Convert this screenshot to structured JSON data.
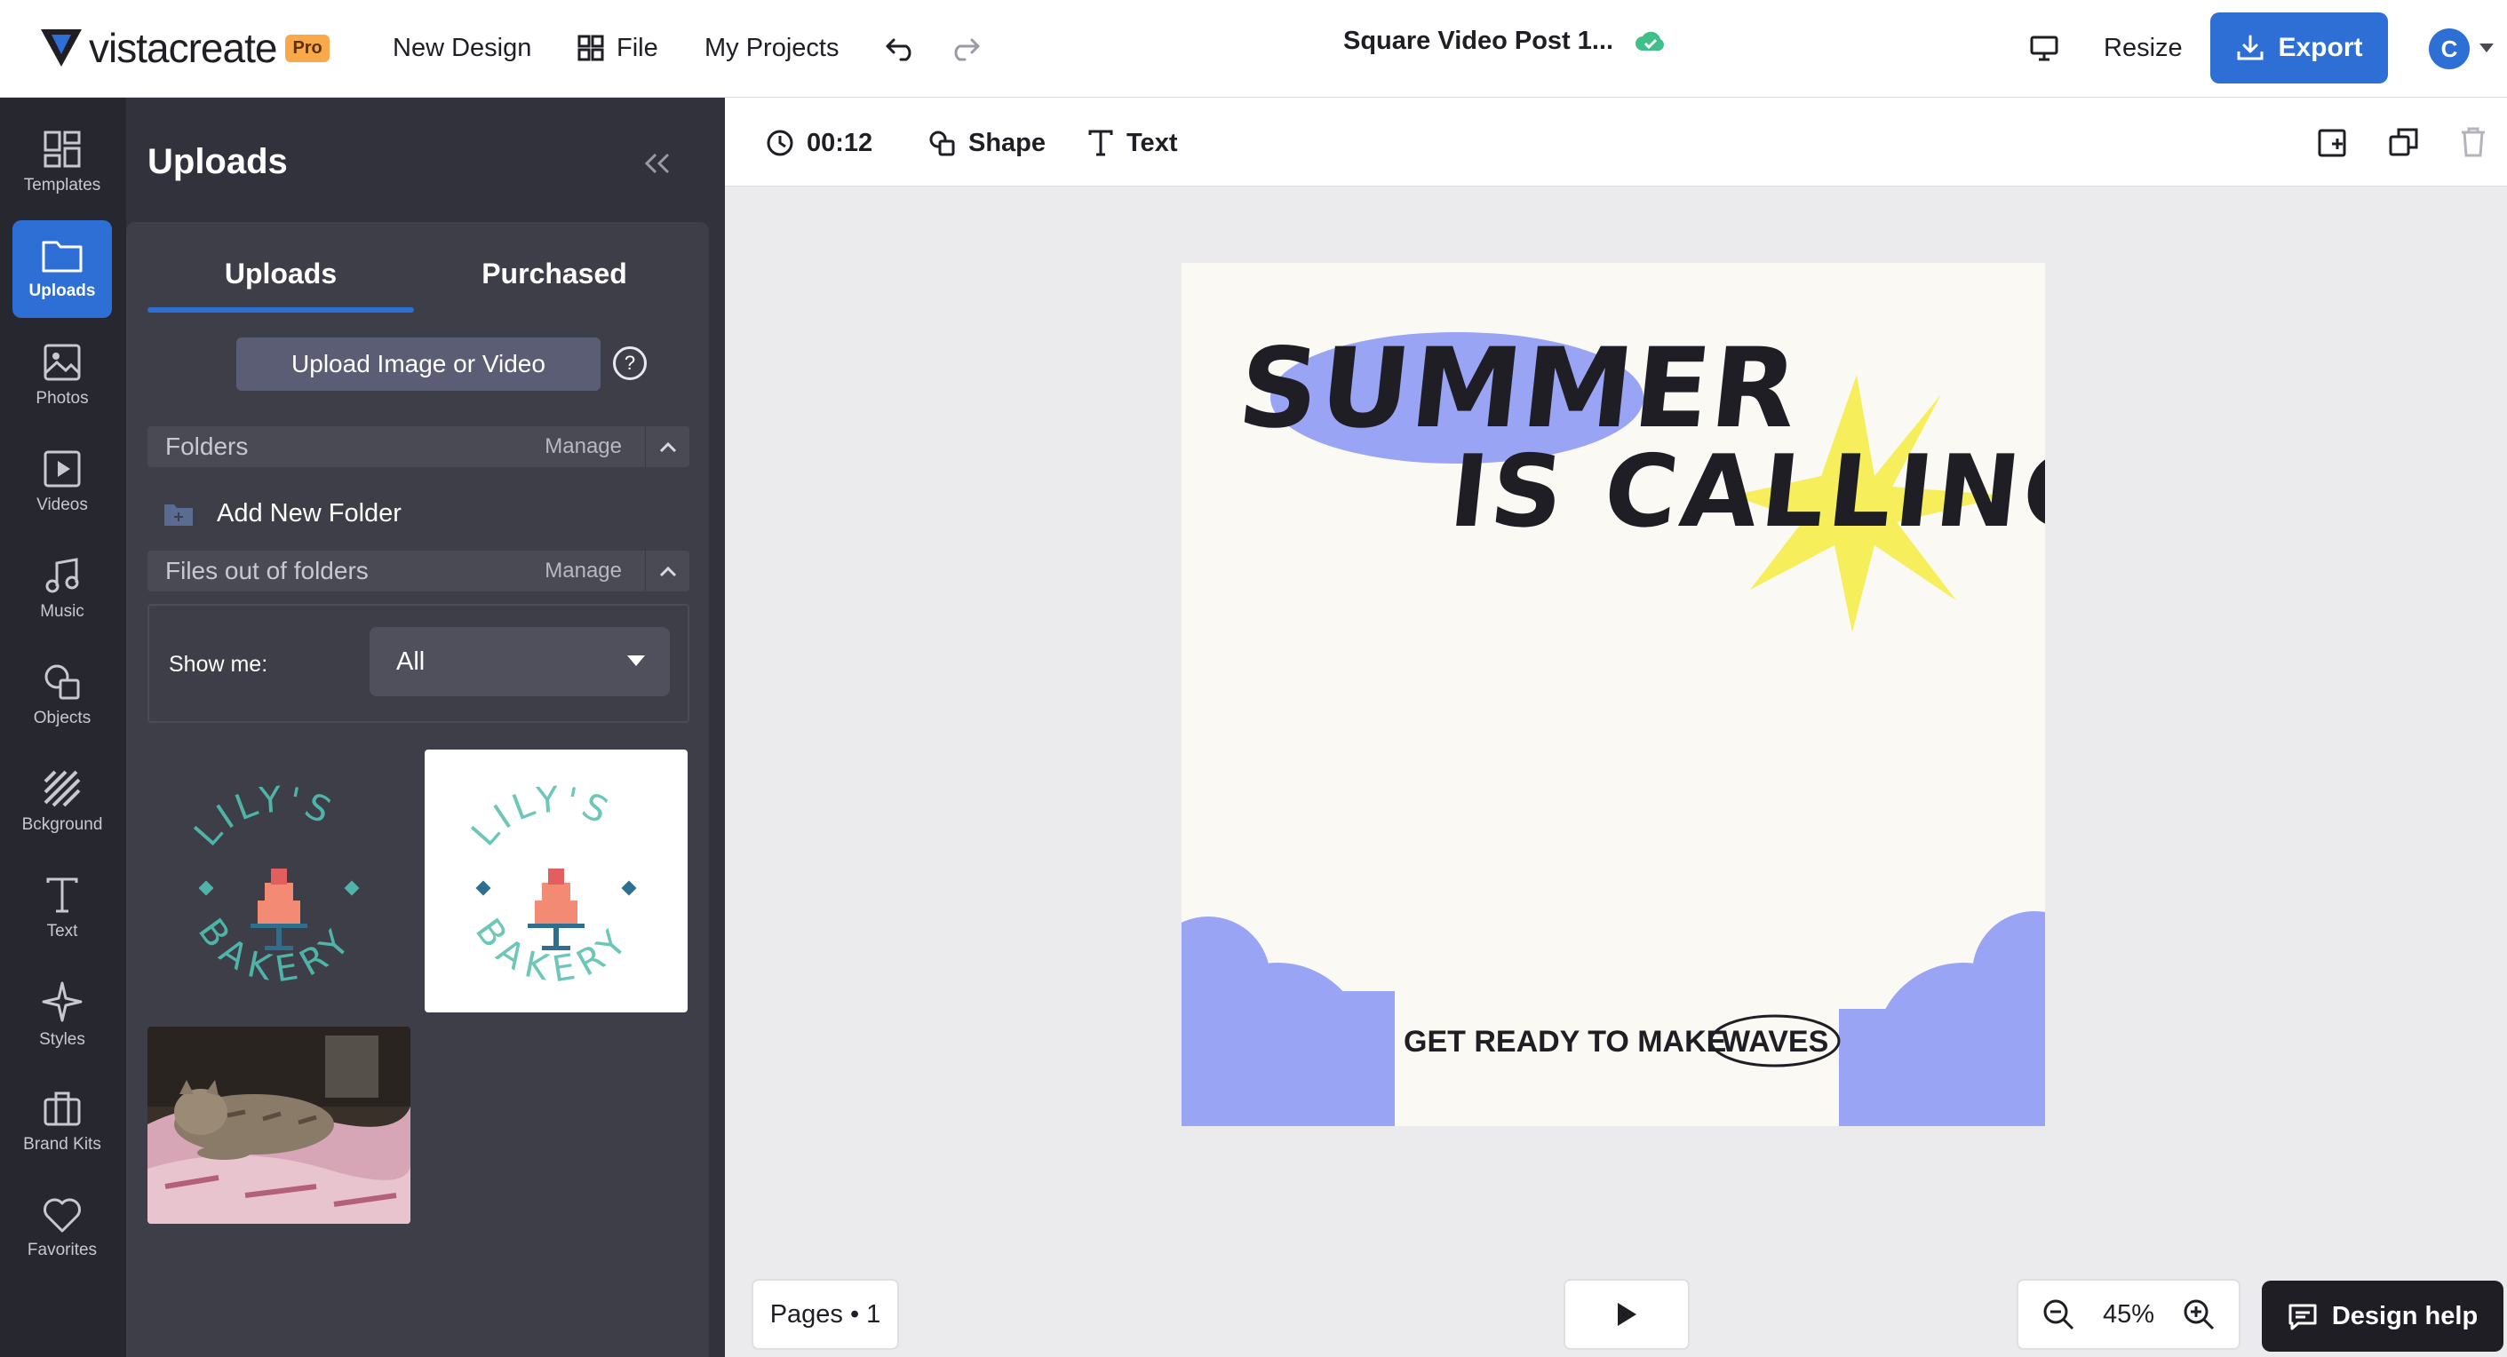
{
  "app": {
    "logo_text": "vistacreate",
    "pro_badge": "Pro",
    "brand_color": "#2e6fd6"
  },
  "topbar": {
    "new_design": "New Design",
    "file": "File",
    "my_projects": "My Projects",
    "doc_title": "Square Video Post 1...",
    "resize": "Resize",
    "export": "Export",
    "avatar_initial": "C"
  },
  "rail": [
    {
      "label": "Templates",
      "icon": "templates-icon"
    },
    {
      "label": "Uploads",
      "icon": "folder-icon",
      "active": true
    },
    {
      "label": "Photos",
      "icon": "photo-icon"
    },
    {
      "label": "Videos",
      "icon": "video-icon"
    },
    {
      "label": "Music",
      "icon": "music-icon"
    },
    {
      "label": "Objects",
      "icon": "objects-icon"
    },
    {
      "label": "Bckground",
      "icon": "background-icon"
    },
    {
      "label": "Text",
      "icon": "text-icon"
    },
    {
      "label": "Styles",
      "icon": "sparkle-icon"
    },
    {
      "label": "Brand Kits",
      "icon": "briefcase-icon"
    },
    {
      "label": "Favorites",
      "icon": "heart-icon"
    }
  ],
  "panel": {
    "title": "Uploads",
    "tabs": [
      "Uploads",
      "Purchased"
    ],
    "upload_button": "Upload Image or Video",
    "help": "?",
    "folders_label": "Folders",
    "manage": "Manage",
    "add_folder": "Add New Folder",
    "files_label": "Files out of folders",
    "show_me_label": "Show me:",
    "show_me_value": "All"
  },
  "uploads": [
    {
      "type": "logo",
      "title": "LILY'S",
      "subtitle": "BAKERY",
      "bg": "dark"
    },
    {
      "type": "logo",
      "title": "LILY'S",
      "subtitle": "BAKERY",
      "bg": "white"
    },
    {
      "type": "photo",
      "subject": "cat"
    }
  ],
  "canvas_toolbar": {
    "duration": "00:12",
    "shape": "Shape",
    "text": "Text"
  },
  "design": {
    "headline_1": "SUMMER",
    "headline_2": "IS CALLING!",
    "tagline_prefix": "GET READY TO MAKE",
    "tagline_emphasis": "WAVES",
    "accent_blue": "#9aa4f5",
    "accent_yellow": "#f6ee5a"
  },
  "footer": {
    "pages": "Pages • 1",
    "zoom": "45%",
    "design_help": "Design help"
  }
}
